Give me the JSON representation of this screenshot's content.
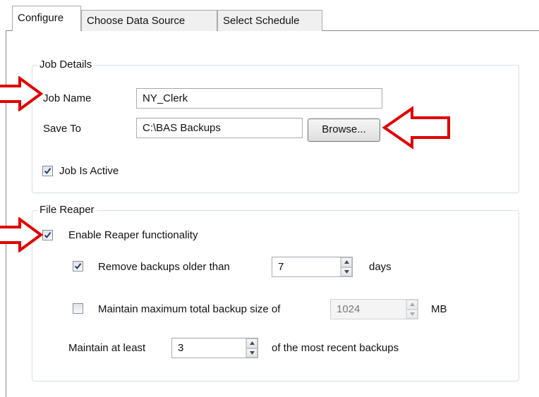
{
  "tabs": [
    {
      "label": "Configure"
    },
    {
      "label": "Choose Data Source"
    },
    {
      "label": "Select Schedule"
    }
  ],
  "job_details": {
    "legend": "Job Details",
    "job_name_label": "Job Name",
    "job_name_value": "NY_Clerk",
    "save_to_label": "Save To",
    "save_to_value": "C:\\BAS Backups",
    "browse_label": "Browse...",
    "job_active_label": "Job Is Active",
    "job_active_checked": true
  },
  "file_reaper": {
    "legend": "File Reaper",
    "enable_label": "Enable Reaper functionality",
    "enable_checked": true,
    "remove_label": "Remove backups older than",
    "remove_checked": true,
    "remove_value": "7",
    "remove_unit": "days",
    "max_size_label": "Maintain maximum total backup size of",
    "max_size_checked": false,
    "max_size_value": "1024",
    "max_size_unit": "MB",
    "maintain_label": "Maintain at least",
    "maintain_value": "3",
    "maintain_suffix": "of the most recent backups"
  },
  "colors": {
    "annotation_arrow": "#e00000"
  }
}
